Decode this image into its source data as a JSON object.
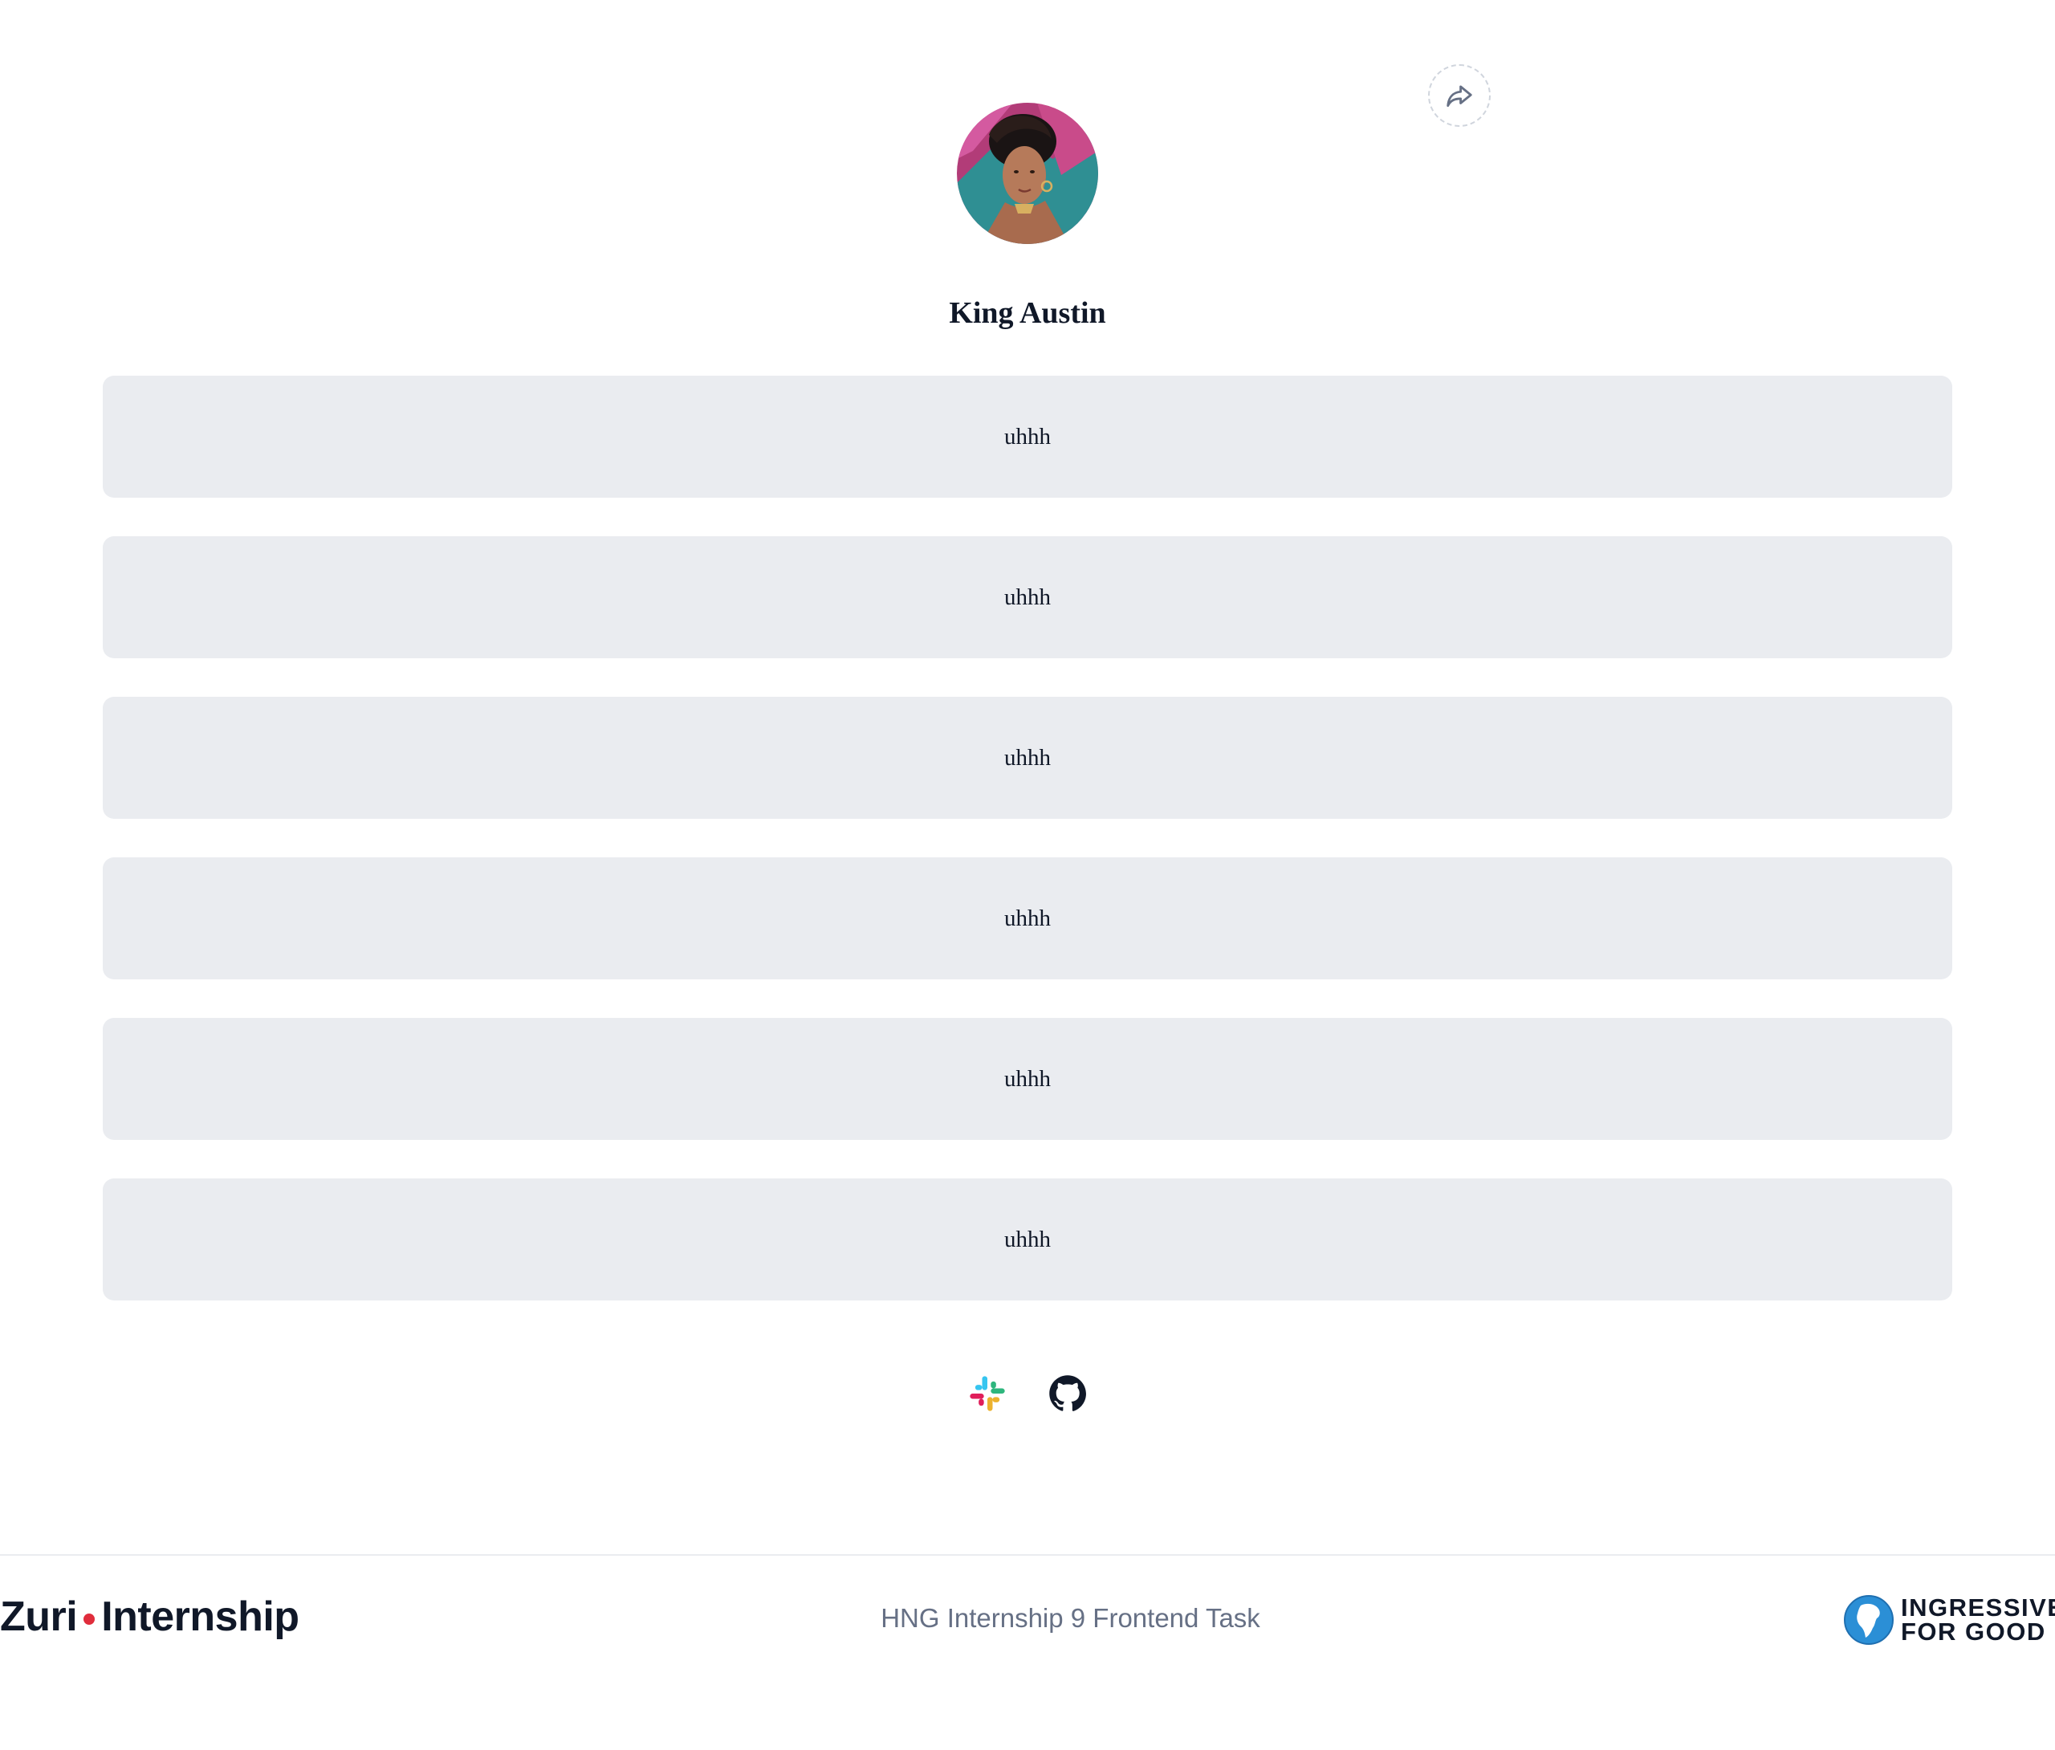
{
  "profile": {
    "name": "King Austin",
    "avatar_icon": "profile-photo"
  },
  "share": {
    "icon": "share-arrow-icon"
  },
  "links": [
    {
      "label": "uhhh"
    },
    {
      "label": "uhhh"
    },
    {
      "label": "uhhh"
    },
    {
      "label": "uhhh"
    },
    {
      "label": "uhhh"
    },
    {
      "label": "uhhh"
    }
  ],
  "socials": [
    {
      "icon": "slack-icon"
    },
    {
      "icon": "github-icon"
    }
  ],
  "footer": {
    "zuri_part1": "Zuri",
    "zuri_part2": "Internship",
    "text": "HNG Internship 9 Frontend Task",
    "i4g_line1": "INGRESSIVE",
    "i4g_line2": "FOR GOOD"
  },
  "colors": {
    "link_background": "#eaecf0",
    "text_primary": "#101828",
    "text_muted": "#667085",
    "zuri_dot": "#e02d3c"
  }
}
